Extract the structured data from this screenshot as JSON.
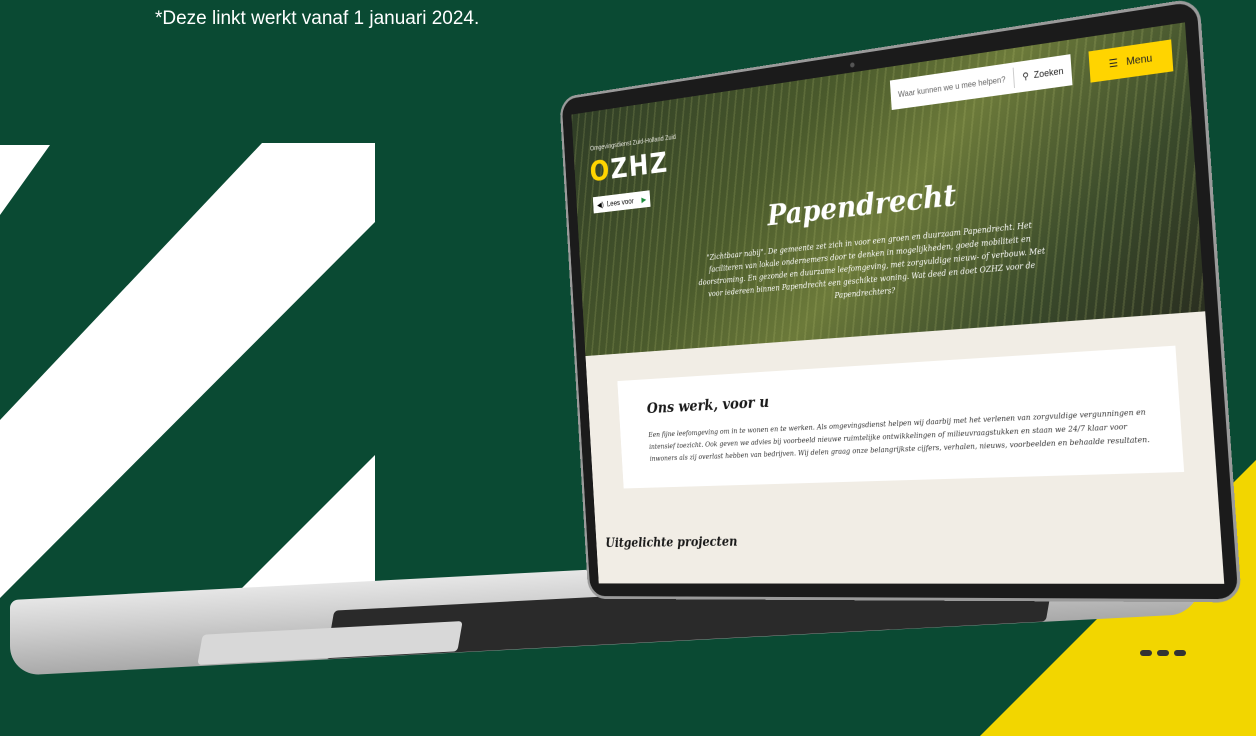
{
  "footnote": "*Deze linkt werkt vanaf 1 januari 2024.",
  "site": {
    "logo_caption": "Omgevingsdienst Zuid-Holland Zuid",
    "logo_text": "OZHZ",
    "readspeaker_label": "Lees voor",
    "search_placeholder": "Waar kunnen we u mee helpen?",
    "search_button": "Zoeken",
    "menu_label": "Menu",
    "hero_title": "Papendrecht",
    "hero_text": "\"Zichtbaar nabij\". De gemeente zet zich in voor een groen en duurzaam Papendrecht. Het faciliteren van lokale ondernemers door te denken in mogelijkheden, goede mobiliteit en doorstroming. En gezonde en duurzame leefomgeving, met zorgvuldige nieuw- of verbouw. Met voor iedereen binnen Papendrecht een geschikte woning. Wat deed en doet OZHZ voor de Papendrechters?",
    "card_title": "Ons werk, voor u",
    "card_text": "Een fijne leefomgeving om in te wonen en te werken. Als omgevingsdienst helpen wij daarbij met het verlenen van zorgvuldige vergunningen en intensief toezicht. Ook geven we advies bij voorbeeld nieuwe ruimtelijke ontwikkelingen of milieuvraagstukken en staan we 24/7 klaar voor inwoners als zij overlast hebben van bedrijven. Wij delen graag onze belangrijkste cijfers, verhalen, nieuws, voorbeelden en behaalde resultaten.",
    "section_heading": "Uitgelichte projecten"
  },
  "colors": {
    "background": "#0a4a33",
    "accent_yellow": "#ffd400",
    "white": "#ffffff"
  },
  "icons": [
    "play-icon",
    "speaker-icon",
    "search-icon",
    "hamburger-icon"
  ]
}
